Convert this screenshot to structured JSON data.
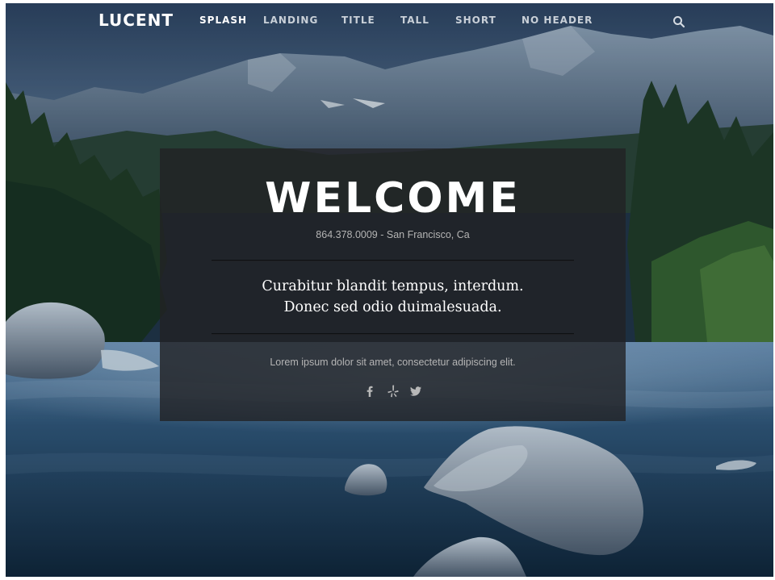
{
  "nav": {
    "logo": "LUCENT",
    "items": [
      {
        "label": "SPLASH",
        "active": true
      },
      {
        "label": "LANDING",
        "active": false
      },
      {
        "label": "TITLE",
        "active": false
      },
      {
        "label": "TALL",
        "active": false
      },
      {
        "label": "SHORT",
        "active": false
      },
      {
        "label": "NO HEADER",
        "active": false
      }
    ],
    "search_icon": "search-icon"
  },
  "hero": {
    "title": "WELCOME",
    "contact": "864.378.0009 - San Francisco, Ca",
    "tagline_line1": "Curabitur blandit tempus, interdum.",
    "tagline_line2": "Donec sed odio duimalesuada.",
    "body": "Lorem ipsum dolor sit amet, consectetur adipiscing elit.",
    "social": [
      "facebook-icon",
      "yelp-icon",
      "twitter-icon"
    ]
  },
  "colors": {
    "panel": "#222224",
    "text": "#ffffff",
    "muted": "#b4b4b4",
    "nav_inactive": "#c9d0d8"
  }
}
